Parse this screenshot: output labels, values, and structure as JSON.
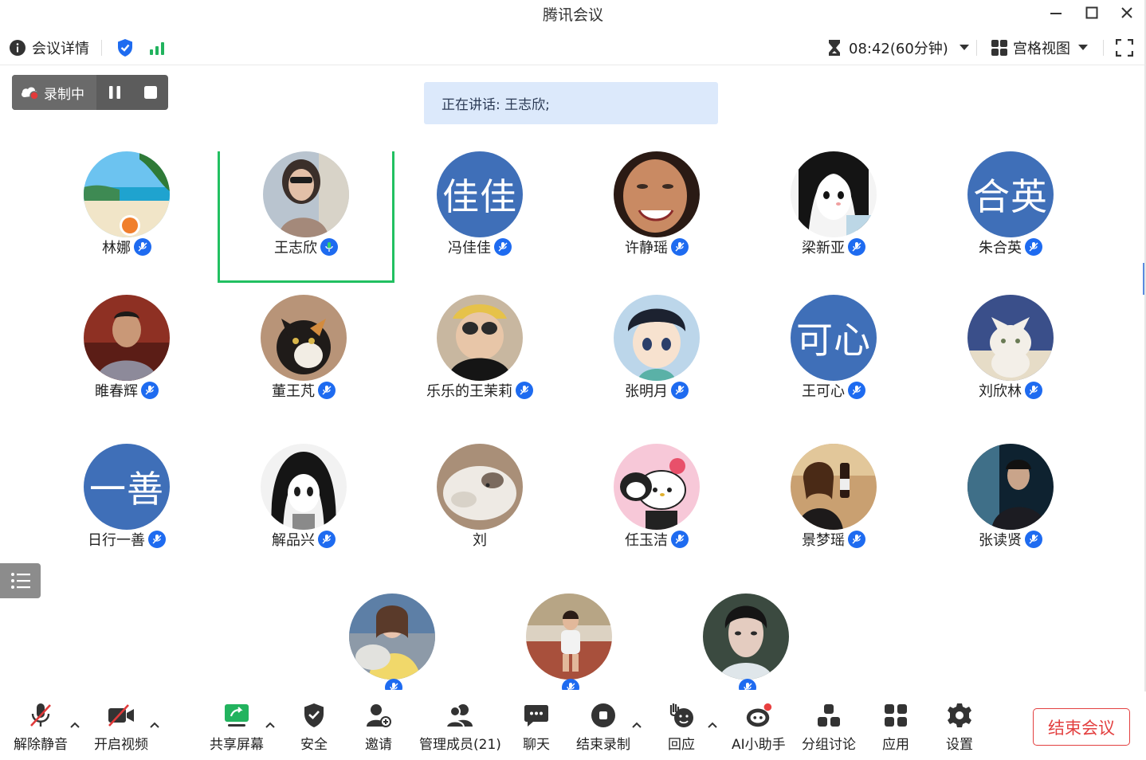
{
  "window": {
    "title": "腾讯会议"
  },
  "topbar": {
    "details_label": "会议详情",
    "timer": "08:42(60分钟)",
    "view_label": "宫格视图"
  },
  "recording": {
    "label": "录制中"
  },
  "speaking": {
    "text": "正在讲话: 王志欣;"
  },
  "participants": [
    {
      "name": "林娜",
      "avatar": "photo-beach",
      "host": true,
      "mic": "muted"
    },
    {
      "name": "王志欣",
      "avatar": "photo-woman-sunglasses",
      "active": true,
      "mic": "speaking"
    },
    {
      "name": "冯佳佳",
      "avatar_text": "佳佳",
      "mic": "muted"
    },
    {
      "name": "许静瑶",
      "avatar": "photo-smiling-woman",
      "mic": "muted"
    },
    {
      "name": "梁新亚",
      "avatar": "photo-anime-girl",
      "mic": "muted"
    },
    {
      "name": "朱合英",
      "avatar_text": "合英",
      "mic": "muted"
    },
    {
      "name": "睢春辉",
      "avatar": "photo-man-red",
      "mic": "muted"
    },
    {
      "name": "董王芃",
      "avatar": "photo-calico-cat",
      "mic": "muted"
    },
    {
      "name": "乐乐的王茉莉",
      "avatar": "photo-child-glasses",
      "mic": "muted"
    },
    {
      "name": "张明月",
      "avatar": "photo-anime-boy",
      "mic": "muted"
    },
    {
      "name": "王可心",
      "avatar_text": "可心",
      "mic": "muted"
    },
    {
      "name": "刘欣林",
      "avatar": "photo-white-cat",
      "mic": "muted"
    },
    {
      "name": "日行一善",
      "avatar_text": "一善",
      "mic": "muted"
    },
    {
      "name": "解品兴",
      "avatar": "photo-manga-girl",
      "mic": "muted"
    },
    {
      "name": "刘",
      "avatar": "photo-fluffy-cat",
      "mic": "none"
    },
    {
      "name": "任玉洁",
      "avatar": "photo-hello-kitty",
      "mic": "muted"
    },
    {
      "name": "景梦瑶",
      "avatar": "photo-woman-wine",
      "mic": "muted"
    },
    {
      "name": "张读贤",
      "avatar": "photo-man-dark",
      "mic": "muted"
    },
    {
      "name": "",
      "avatar": "photo-woman-yellow",
      "mic": "muted"
    },
    {
      "name": "",
      "avatar": "photo-girl-track",
      "mic": "muted"
    },
    {
      "name": "",
      "avatar": "photo-man-costume",
      "mic": "muted"
    }
  ],
  "bottombar": {
    "unmute": "解除静音",
    "video": "开启视频",
    "share": "共享屏幕",
    "security": "安全",
    "invite": "邀请",
    "members": "管理成员(21)",
    "chat": "聊天",
    "stop_record": "结束录制",
    "react": "回应",
    "ai": "AI小助手",
    "breakout": "分组讨论",
    "apps": "应用",
    "settings": "设置",
    "end": "结束会议"
  },
  "colors": {
    "avatar_blue": "#3f6fb8",
    "active_border": "#22c061",
    "mic_blue": "#1e6bf0",
    "end_red": "#e34040",
    "banner_bg": "#dce9fb"
  }
}
